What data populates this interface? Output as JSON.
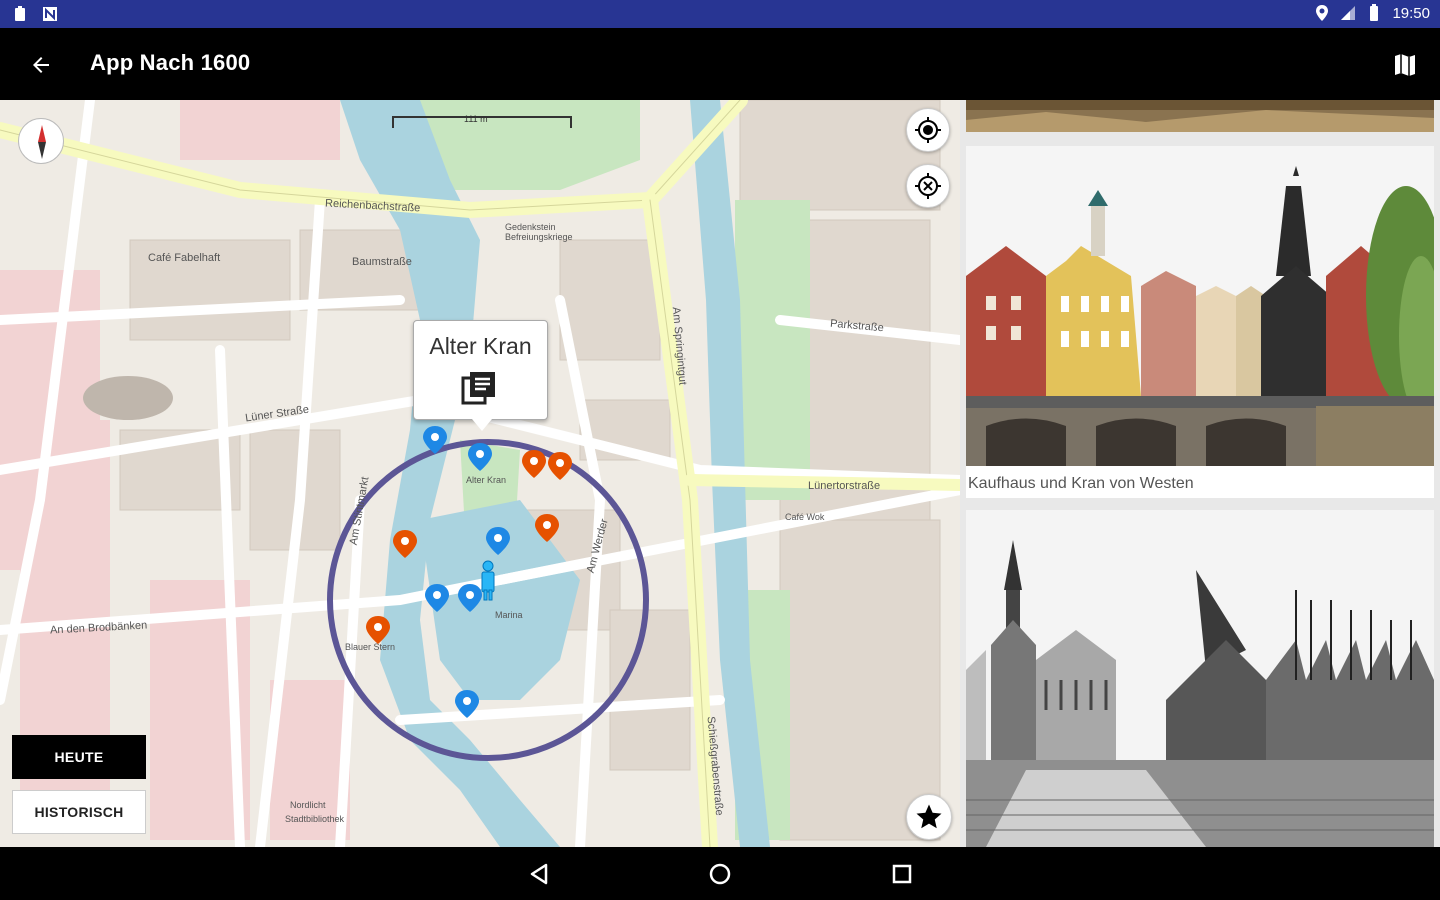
{
  "status_bar": {
    "time": "19:50",
    "left_icons": [
      "clipboard-icon",
      "n-icon"
    ],
    "right_icons": [
      "location-icon",
      "signal-icon",
      "battery-icon"
    ],
    "color": "#283593"
  },
  "app_bar": {
    "title": "App Nach 1600",
    "back_icon": "arrow-back-icon",
    "map_icon": "map-icon"
  },
  "map": {
    "scale_label": "111 m",
    "streets": [
      "Reichenbachstraße",
      "Baumstraße",
      "Lüner Straße",
      "Am Stintmarkt",
      "Lünertorstraße",
      "An den Brodbänken",
      "Parkstraße",
      "Am Werder",
      "Schießgrabenstraße",
      "Am Springintgut"
    ],
    "pois": [
      "Café Fabelhaft",
      "Gedenkstein Befreiungskriege",
      "Alter Kran",
      "Marina",
      "Café Wok",
      "Blauer Stern",
      "Nordlicht",
      "Stadtbibliothek"
    ],
    "callout_title": "Alter Kran",
    "marker_colors": {
      "blue": "#1E88E5",
      "orange": "#E65100"
    },
    "circle_color": "#5C5696",
    "buttons": {
      "today": "HEUTE",
      "historic": "HISTORISCH"
    },
    "controls": [
      "my-location-icon",
      "clear-location-icon",
      "star-icon",
      "compass-icon"
    ]
  },
  "gallery": {
    "items": [
      {
        "caption": ""
      },
      {
        "caption": "Kaufhaus und Kran von Westen"
      },
      {
        "caption": ""
      }
    ]
  },
  "nav_bar": {
    "buttons": [
      "back-triangle-icon",
      "home-circle-icon",
      "recents-square-icon"
    ]
  }
}
